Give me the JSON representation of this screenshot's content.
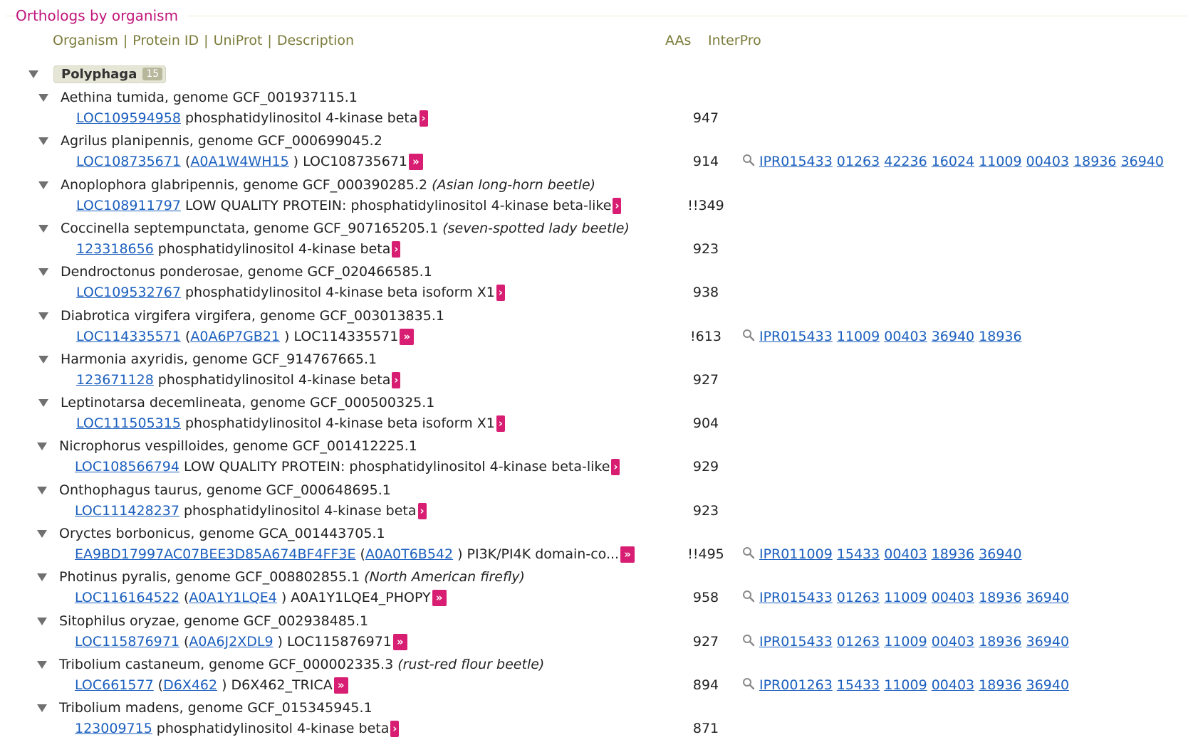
{
  "section_title": "Orthologs by organism",
  "header": {
    "organism": "Organism",
    "protein_id": "Protein ID",
    "uniprot": "UniProt",
    "description": "Description",
    "sep": "|",
    "aas": "AAs",
    "interpro": "InterPro"
  },
  "group": {
    "name": "Polyphaga",
    "count": "15"
  },
  "icons": {
    "expand": "triangle-down-icon",
    "go_link": "double-chevron-right-icon",
    "search": "magnifier-icon"
  },
  "colors": {
    "title": "#c0157a",
    "link": "#1b5fbe",
    "go_badge": "#d81e72",
    "header": "#7b7b3a"
  },
  "organisms": [
    {
      "name": "Aethina tumida, genome GCF_001937115.1",
      "common": "",
      "protein": "LOC109594958",
      "uniprot": "",
      "description": "phosphatidylinositol 4-kinase beta",
      "aas": "947",
      "interpro": []
    },
    {
      "name": "Agrilus planipennis, genome GCF_000699045.2",
      "common": "",
      "protein": "LOC108735671",
      "uniprot": "A0A1W4WH15",
      "description": "LOC108735671",
      "aas": "914",
      "interpro": [
        "IPR015433",
        "01263",
        "42236",
        "16024",
        "11009",
        "00403",
        "18936",
        "36940"
      ]
    },
    {
      "name": "Anoplophora glabripennis, genome GCF_000390285.2",
      "common": "(Asian long-horn beetle)",
      "protein": "LOC108911797",
      "uniprot": "",
      "description": "LOW QUALITY PROTEIN: phosphatidylinositol 4-kinase beta-like",
      "aas": "!!349",
      "interpro": []
    },
    {
      "name": "Coccinella septempunctata, genome GCF_907165205.1",
      "common": "(seven-spotted lady beetle)",
      "protein": "123318656",
      "uniprot": "",
      "description": "phosphatidylinositol 4-kinase beta",
      "aas": "923",
      "interpro": []
    },
    {
      "name": "Dendroctonus ponderosae, genome GCF_020466585.1",
      "common": "",
      "protein": "LOC109532767",
      "uniprot": "",
      "description": "phosphatidylinositol 4-kinase beta isoform X1",
      "aas": "938",
      "interpro": []
    },
    {
      "name": "Diabrotica virgifera virgifera, genome GCF_003013835.1",
      "common": "",
      "protein": "LOC114335571",
      "uniprot": "A0A6P7GB21",
      "description": "LOC114335571",
      "aas": "!613",
      "interpro": [
        "IPR015433",
        "11009",
        "00403",
        "36940",
        "18936"
      ]
    },
    {
      "name": "Harmonia axyridis, genome GCF_914767665.1",
      "common": "",
      "protein": "123671128",
      "uniprot": "",
      "description": "phosphatidylinositol 4-kinase beta",
      "aas": "927",
      "interpro": []
    },
    {
      "name": "Leptinotarsa decemlineata, genome GCF_000500325.1",
      "common": "",
      "protein": "LOC111505315",
      "uniprot": "",
      "description": "phosphatidylinositol 4-kinase beta isoform X1",
      "aas": "904",
      "interpro": []
    },
    {
      "name": "Nicrophorus vespilloides, genome GCF_001412225.1",
      "common": "",
      "protein": "LOC108566794",
      "uniprot": "",
      "description": "LOW QUALITY PROTEIN: phosphatidylinositol 4-kinase beta-like",
      "aas": "929",
      "interpro": []
    },
    {
      "name": "Onthophagus taurus, genome GCF_000648695.1",
      "common": "",
      "protein": "LOC111428237",
      "uniprot": "",
      "description": "phosphatidylinositol 4-kinase beta",
      "aas": "923",
      "interpro": []
    },
    {
      "name": "Oryctes borbonicus, genome GCA_001443705.1",
      "common": "",
      "protein": "EA9BD17997AC07BEE3D85A674BF4FF3E",
      "uniprot": "A0A0T6B542",
      "description": "PI3K/PI4K domain-co...",
      "aas": "!!495",
      "interpro": [
        "IPR011009",
        "15433",
        "00403",
        "18936",
        "36940"
      ]
    },
    {
      "name": "Photinus pyralis, genome GCF_008802855.1",
      "common": "(North American firefly)",
      "protein": "LOC116164522",
      "uniprot": "A0A1Y1LQE4",
      "description": "A0A1Y1LQE4_PHOPY",
      "aas": "958",
      "interpro": [
        "IPR015433",
        "01263",
        "11009",
        "00403",
        "18936",
        "36940"
      ]
    },
    {
      "name": "Sitophilus oryzae, genome GCF_002938485.1",
      "common": "",
      "protein": "LOC115876971",
      "uniprot": "A0A6J2XDL9",
      "description": "LOC115876971",
      "aas": "927",
      "interpro": [
        "IPR015433",
        "01263",
        "11009",
        "00403",
        "18936",
        "36940"
      ]
    },
    {
      "name": "Tribolium castaneum, genome GCF_000002335.3",
      "common": "(rust-red flour beetle)",
      "protein": "LOC661577",
      "uniprot": "D6X462",
      "description": "D6X462_TRICA",
      "aas": "894",
      "interpro": [
        "IPR001263",
        "15433",
        "11009",
        "00403",
        "18936",
        "36940"
      ]
    },
    {
      "name": "Tribolium madens, genome GCF_015345945.1",
      "common": "",
      "protein": "123009715",
      "uniprot": "",
      "description": "phosphatidylinositol 4-kinase beta",
      "aas": "871",
      "interpro": []
    }
  ]
}
